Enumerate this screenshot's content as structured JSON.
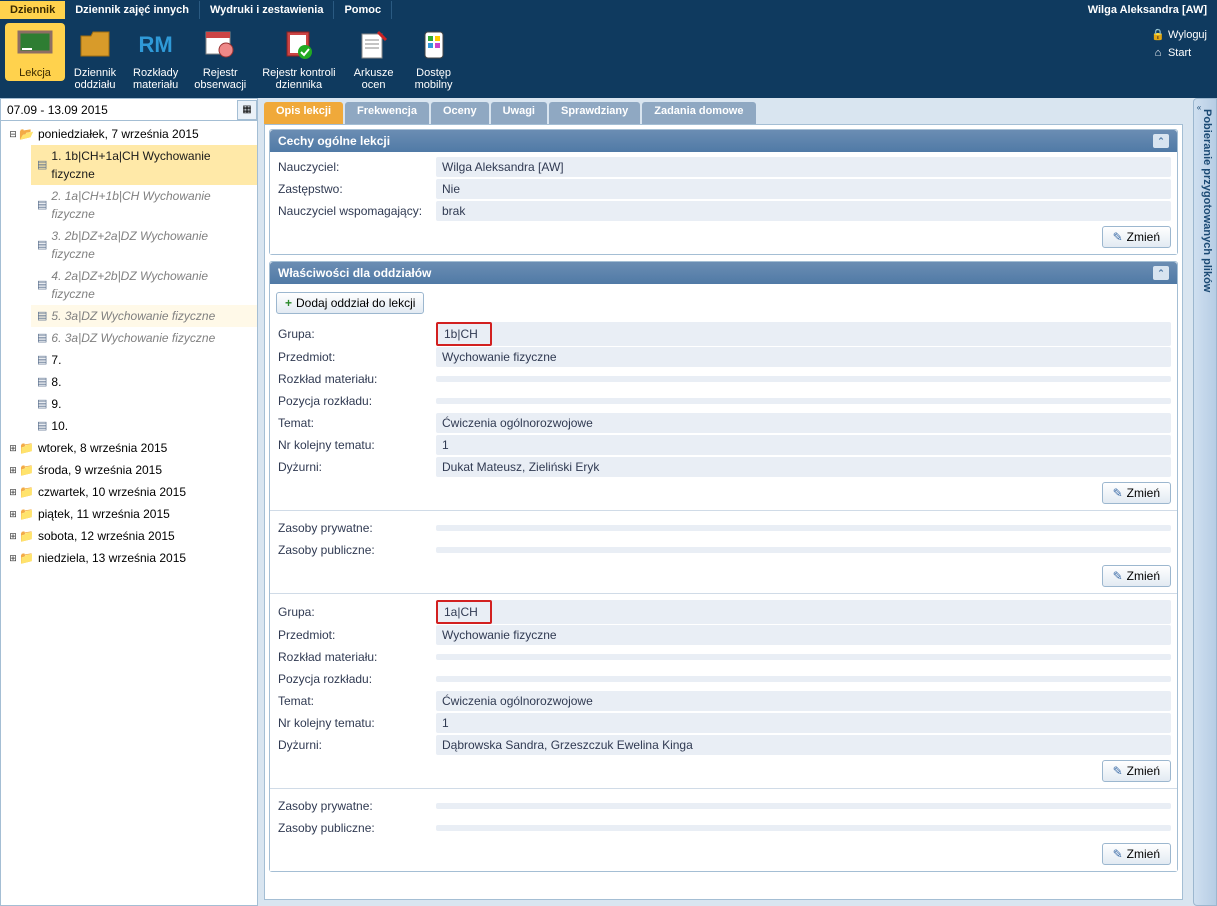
{
  "user": "Wilga Aleksandra [AW]",
  "menus": [
    "Dziennik",
    "Dziennik zajęć innych",
    "Wydruki i zestawienia",
    "Pomoc"
  ],
  "activeMenu": 0,
  "ribbon": [
    {
      "label": "Lekcja"
    },
    {
      "label": "Dziennik\noddziału"
    },
    {
      "label": "Rozkłady\nmateriału"
    },
    {
      "label": "Rejestr\nobserwacji"
    },
    {
      "label": "Rejestr kontroli\ndziennika"
    },
    {
      "label": "Arkusze\nocen"
    },
    {
      "label": "Dostęp\nmobilny"
    }
  ],
  "userActions": {
    "logout": "Wyloguj",
    "start": "Start"
  },
  "dateRange": "07.09 - 13.09 2015",
  "tree": {
    "root": "poniedziałek, 7 września 2015",
    "lessons": [
      "1. 1b|CH+1a|CH Wychowanie fizyczne",
      "2. 1a|CH+1b|CH Wychowanie fizyczne",
      "3. 2b|DZ+2a|DZ Wychowanie fizyczne",
      "4. 2a|DZ+2b|DZ Wychowanie fizyczne",
      "5. 3a|DZ Wychowanie fizyczne",
      "6. 3a|DZ Wychowanie fizyczne",
      "7.",
      "8.",
      "9.",
      "10."
    ],
    "days": [
      "wtorek, 8 września 2015",
      "środa, 9 września 2015",
      "czwartek, 10 września 2015",
      "piątek, 11 września 2015",
      "sobota, 12 września 2015",
      "niedziela, 13 września 2015"
    ]
  },
  "subTabs": [
    "Opis lekcji",
    "Frekwencja",
    "Oceny",
    "Uwagi",
    "Sprawdziany",
    "Zadania domowe"
  ],
  "activeSubTab": 0,
  "sections": {
    "general": {
      "title": "Cechy ogólne lekcji",
      "rows": [
        {
          "label": "Nauczyciel:",
          "value": "Wilga Aleksandra [AW]"
        },
        {
          "label": "Zastępstwo:",
          "value": "Nie"
        },
        {
          "label": "Nauczyciel wspomagający:",
          "value": "brak"
        }
      ],
      "changeBtn": "Zmień"
    },
    "props": {
      "title": "Właściwości dla oddziałów",
      "addBtn": "Dodaj oddział do lekcji",
      "groups": [
        {
          "groupVal": "1b|CH",
          "rows": [
            {
              "label": "Przedmiot:",
              "value": "Wychowanie fizyczne"
            },
            {
              "label": "Rozkład materiału:",
              "value": ""
            },
            {
              "label": "Pozycja rozkładu:",
              "value": ""
            },
            {
              "label": "Temat:",
              "value": "Ćwiczenia ogólnorozwojowe"
            },
            {
              "label": "Nr kolejny tematu:",
              "value": "1"
            },
            {
              "label": "Dyżurni:",
              "value": "Dukat Mateusz, Zieliński Eryk"
            }
          ],
          "resources": [
            {
              "label": "Zasoby prywatne:",
              "value": ""
            },
            {
              "label": "Zasoby publiczne:",
              "value": ""
            }
          ]
        },
        {
          "groupVal": "1a|CH",
          "rows": [
            {
              "label": "Przedmiot:",
              "value": "Wychowanie fizyczne"
            },
            {
              "label": "Rozkład materiału:",
              "value": ""
            },
            {
              "label": "Pozycja rozkładu:",
              "value": ""
            },
            {
              "label": "Temat:",
              "value": "Ćwiczenia ogólnorozwojowe"
            },
            {
              "label": "Nr kolejny tematu:",
              "value": "1"
            },
            {
              "label": "Dyżurni:",
              "value": "Dąbrowska Sandra, Grzeszczuk Ewelina Kinga"
            }
          ],
          "resources": [
            {
              "label": "Zasoby prywatne:",
              "value": ""
            },
            {
              "label": "Zasoby publiczne:",
              "value": ""
            }
          ]
        }
      ],
      "groupLabel": "Grupa:",
      "changeBtn": "Zmień"
    }
  },
  "flyout": "Pobieranie przygotowanych plików"
}
